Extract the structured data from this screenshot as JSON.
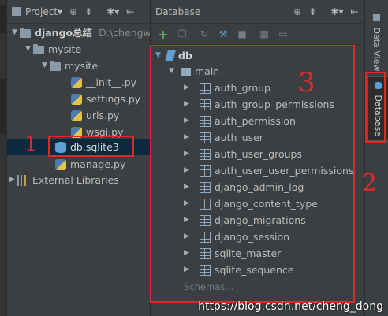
{
  "project_panel": {
    "title": "Project▾",
    "tree": [
      {
        "label": "django总结",
        "path": "D:\\chengwe"
      },
      {
        "label": "mysite"
      },
      {
        "label": "mysite"
      },
      {
        "label": "__init__.py"
      },
      {
        "label": "settings.py"
      },
      {
        "label": "urls.py"
      },
      {
        "label": "wsgi.py"
      },
      {
        "label": "db.sqlite3"
      },
      {
        "label": "manage.py"
      },
      {
        "label": "External Libraries"
      }
    ]
  },
  "db_panel": {
    "title": "Database",
    "root": "db",
    "schema": "main",
    "tables": [
      "auth_group",
      "auth_group_permissions",
      "auth_permission",
      "auth_user",
      "auth_user_groups",
      "auth_user_user_permissions",
      "django_admin_log",
      "django_content_type",
      "django_migrations",
      "django_session",
      "sqlite_master",
      "sqlite_sequence"
    ],
    "schemas_placeholder": "Schemas..."
  },
  "right_tabs": {
    "data_view": "Data View",
    "database": "Database"
  },
  "annotations": {
    "one": "1",
    "two": "2",
    "three": "3"
  },
  "watermark": "https://blog.csdn.net/cheng_dong",
  "colors": {
    "accent": "#e02a2a",
    "selection": "#0d293e",
    "background": "#3c3f41"
  }
}
